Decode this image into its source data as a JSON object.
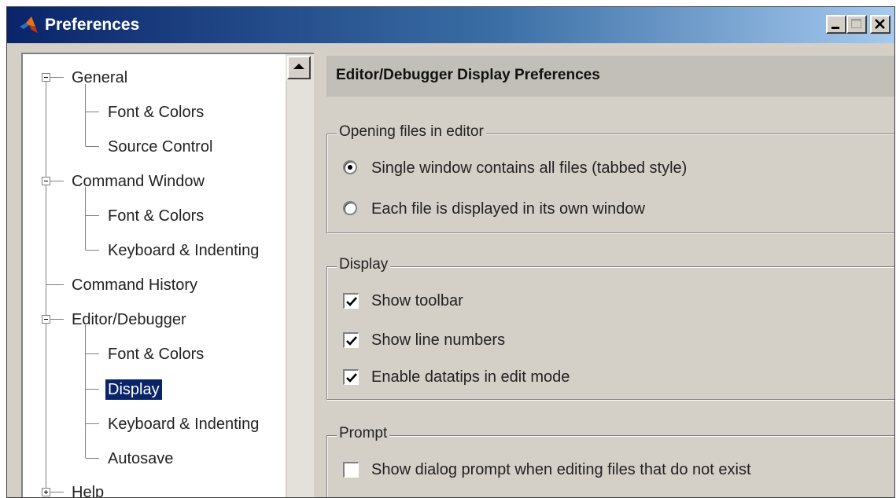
{
  "window": {
    "title": "Preferences",
    "icon": "matlab-logo-icon"
  },
  "tree": {
    "nodes": [
      {
        "label": "General",
        "expander": "minus"
      },
      {
        "label": "Font & Colors"
      },
      {
        "label": "Source Control"
      },
      {
        "label": "Command Window",
        "expander": "minus"
      },
      {
        "label": "Font & Colors"
      },
      {
        "label": "Keyboard & Indenting"
      },
      {
        "label": "Command History"
      },
      {
        "label": "Editor/Debugger",
        "expander": "minus"
      },
      {
        "label": "Font & Colors"
      },
      {
        "label": "Display",
        "selected": true
      },
      {
        "label": "Keyboard & Indenting"
      },
      {
        "label": "Autosave"
      },
      {
        "label": "Help",
        "expander": "plus"
      }
    ]
  },
  "panel": {
    "title": "Editor/Debugger Display Preferences",
    "groups": {
      "opening": {
        "legend": "Opening files in editor",
        "options": [
          {
            "label": "Single window contains all files (tabbed style)",
            "checked": true
          },
          {
            "label": "Each file is displayed in its own window",
            "checked": false
          }
        ]
      },
      "display": {
        "legend": "Display",
        "options": [
          {
            "label": "Show toolbar",
            "checked": true
          },
          {
            "label": "Show line numbers",
            "checked": true
          },
          {
            "label": "Enable datatips in edit mode",
            "checked": true
          }
        ]
      },
      "prompt": {
        "legend": "Prompt",
        "options": [
          {
            "label": "Show dialog prompt when editing files that do not exist",
            "checked": false
          }
        ]
      }
    }
  },
  "colors": {
    "title_gradient_start": "#0a246a",
    "title_gradient_end": "#a6caf0",
    "selection": "#0a246a",
    "dialog_bg": "#d4d0c8"
  }
}
